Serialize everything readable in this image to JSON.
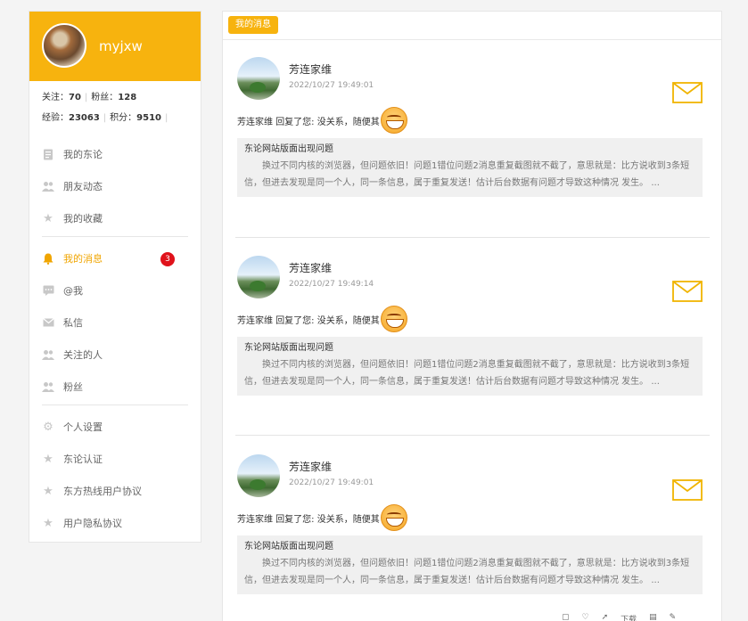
{
  "breadcrumb": "",
  "sidebar": {
    "username": "myjxw",
    "stats": {
      "follow_label": "关注：",
      "follow_value": "70",
      "fans_label": "粉丝：",
      "fans_value": "128",
      "exp_label": "经验：",
      "exp_value": "23063",
      "points_label": "积分：",
      "points_value": "9510"
    },
    "items": [
      {
        "label": "我的东论",
        "icon": "document-icon"
      },
      {
        "label": "朋友动态",
        "icon": "people-icon"
      },
      {
        "label": "我的收藏",
        "icon": "star-icon"
      },
      {
        "label": "我的消息",
        "icon": "bell-icon",
        "active": true,
        "badge": "3"
      },
      {
        "label": "@我",
        "icon": "chat-bubble-icon"
      },
      {
        "label": "私信",
        "icon": "mail-icon"
      },
      {
        "label": "关注的人",
        "icon": "people-icon"
      },
      {
        "label": "粉丝",
        "icon": "people-icon"
      },
      {
        "label": "个人设置",
        "icon": "gear-icon"
      },
      {
        "label": "东论认证",
        "icon": "star-icon"
      },
      {
        "label": "东方热线用户协议",
        "icon": "star-icon"
      },
      {
        "label": "用户隐私协议",
        "icon": "star-icon"
      }
    ]
  },
  "main": {
    "tab_label": "我的消息",
    "messages": [
      {
        "sender": "芳连家维",
        "time": "2022/10/27 19:49:01",
        "reply": "芳连家维 回复了您: 没关系，随便其",
        "quote_title": "东论网站版面出现问题",
        "quote_body": "换过不同内核的浏览器，但问题依旧！问题1错位问题2消息重复截图就不截了，意思就是：比方说收到3条短信，但进去发现是同一个人，同一条信息，属于重复发送！估计后台数据有问题才导致这种情况 发生。 ..."
      },
      {
        "sender": "芳连家维",
        "time": "2022/10/27 19:49:14",
        "reply": "芳连家维 回复了您: 没关系，随便其",
        "quote_title": "东论网站版面出现问题",
        "quote_body": "换过不同内核的浏览器，但问题依旧！问题1错位问题2消息重复截图就不截了，意思就是：比方说收到3条短信，但进去发现是同一个人，同一条信息，属于重复发送！估计后台数据有问题才导致这种情况 发生。 ..."
      },
      {
        "sender": "芳连家维",
        "time": "2022/10/27 19:49:01",
        "reply": "芳连家维 回复了您: 没关系，随便其",
        "quote_title": "东论网站版面出现问题",
        "quote_body": "换过不同内核的浏览器，但问题依旧！问题1错位问题2消息重复截图就不截了，意思就是：比方说收到3条短信，但进去发现是同一个人，同一条信息，属于重复发送！估计后台数据有问题才导致这种情况 发生。 ..."
      }
    ]
  },
  "bottom_bar": {
    "download_label": "下载"
  },
  "colors": {
    "accent": "#f7b30e",
    "badge": "#e0121b",
    "mail_icon": "#f0b400"
  }
}
